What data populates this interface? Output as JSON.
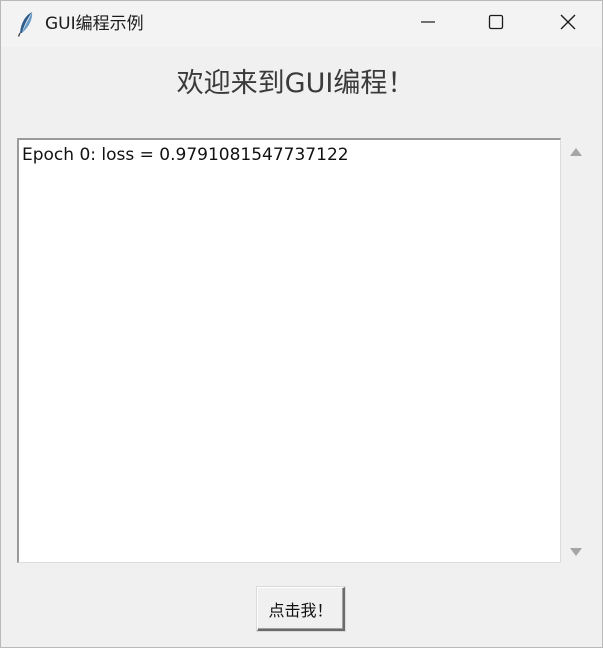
{
  "window": {
    "title": "GUI编程示例",
    "title_icon": "feather-icon",
    "controls": {
      "minimize": "minimize-icon",
      "maximize": "maximize-icon",
      "close": "close-icon"
    }
  },
  "main": {
    "heading": "欢迎来到GUI编程！",
    "textbox": {
      "lines": [
        "Epoch 0: loss = 0.9791081547737122"
      ]
    },
    "button_label": "点击我！"
  }
}
